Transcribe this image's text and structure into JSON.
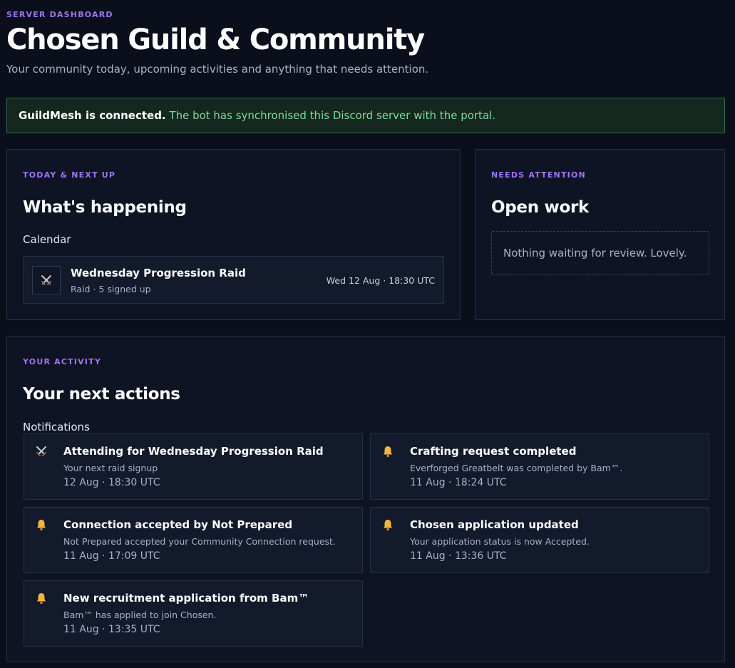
{
  "header": {
    "eyebrow": "SERVER DASHBOARD",
    "title": "Chosen Guild & Community",
    "subtitle": "Your community today, upcoming activities and anything that needs attention."
  },
  "banner": {
    "strong": "GuildMesh is connected.",
    "text": " The bot has synchronised this Discord server with the portal.",
    "color": "#7fdb9b"
  },
  "happening": {
    "eyebrow": "TODAY & NEXT UP",
    "title": "What's happening",
    "section": "Calendar",
    "event": {
      "icon": "crossed-swords-icon",
      "title": "Wednesday Progression Raid",
      "meta": "Raid · 5 signed up",
      "time": "Wed 12 Aug · 18:30 UTC"
    }
  },
  "open_work": {
    "eyebrow": "NEEDS ATTENTION",
    "title": "Open work",
    "empty": "Nothing waiting for review. Lovely."
  },
  "activity": {
    "eyebrow": "YOUR ACTIVITY",
    "title": "Your next actions",
    "section": "Notifications",
    "items": [
      {
        "icon": "crossed-swords-icon",
        "title": "Attending for Wednesday Progression Raid",
        "body": "Your next raid signup",
        "time": "12 Aug · 18:30 UTC"
      },
      {
        "icon": "bell-icon",
        "title": "Crafting request completed",
        "body": "Everforged Greatbelt was completed by Bam™.",
        "time": "11 Aug · 18:24 UTC"
      },
      {
        "icon": "bell-icon",
        "title": "Connection accepted by Not Prepared",
        "body": "Not Prepared accepted your Community Connection request.",
        "time": "11 Aug · 17:09 UTC"
      },
      {
        "icon": "bell-icon",
        "title": "Chosen application updated",
        "body": "Your application status is now Accepted.",
        "time": "11 Aug · 13:36 UTC"
      },
      {
        "icon": "bell-icon",
        "title": "New recruitment application from Bam™",
        "body": "Bam™ has applied to join Chosen.",
        "time": "11 Aug · 13:35 UTC"
      }
    ]
  },
  "colors": {
    "accent": "#a173f5",
    "background": "#0b0f1c",
    "card": "#0e1424",
    "bell": "#f5b53d"
  }
}
